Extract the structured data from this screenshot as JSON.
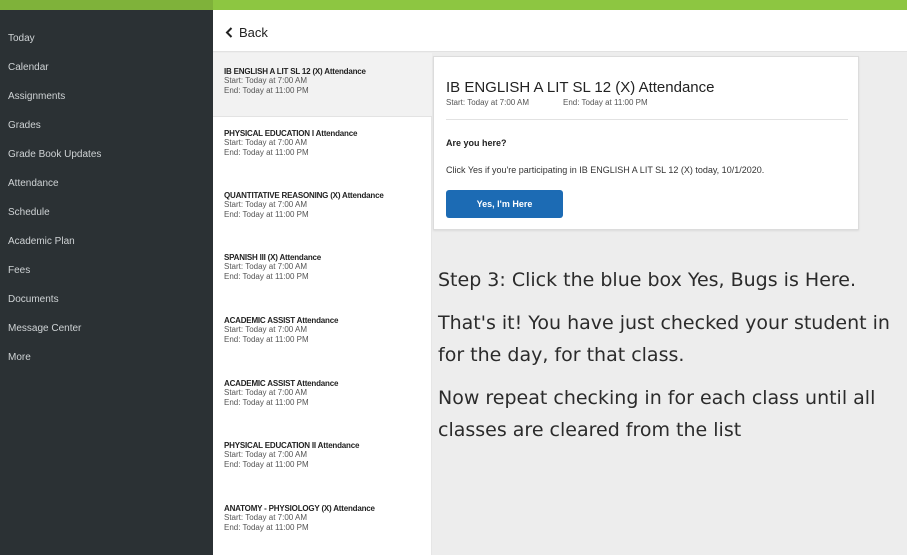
{
  "sidebar": {
    "items": [
      {
        "label": "Today"
      },
      {
        "label": "Calendar"
      },
      {
        "label": "Assignments"
      },
      {
        "label": "Grades"
      },
      {
        "label": "Grade Book Updates"
      },
      {
        "label": "Attendance"
      },
      {
        "label": "Schedule"
      },
      {
        "label": "Academic Plan"
      },
      {
        "label": "Fees"
      },
      {
        "label": "Documents"
      },
      {
        "label": "Message Center"
      },
      {
        "label": "More"
      }
    ]
  },
  "header": {
    "back_label": "Back"
  },
  "list": {
    "items": [
      {
        "title": "IB ENGLISH A LIT SL 12 (X) Attendance",
        "start": "Start: Today at 7:00 AM",
        "end": "End: Today at 11:00 PM"
      },
      {
        "title": "PHYSICAL EDUCATION I Attendance",
        "start": "Start: Today at 7:00 AM",
        "end": "End: Today at 11:00 PM"
      },
      {
        "title": "QUANTITATIVE REASONING (X) Attendance",
        "start": "Start: Today at 7:00 AM",
        "end": "End: Today at 11:00 PM"
      },
      {
        "title": "SPANISH III (X) Attendance",
        "start": "Start: Today at 7:00 AM",
        "end": "End: Today at 11:00 PM"
      },
      {
        "title": "ACADEMIC ASSIST Attendance",
        "start": "Start: Today at 7:00 AM",
        "end": "End: Today at 11:00 PM"
      },
      {
        "title": "ACADEMIC ASSIST Attendance",
        "start": "Start: Today at 7:00 AM",
        "end": "End: Today at 11:00 PM"
      },
      {
        "title": "PHYSICAL EDUCATION II Attendance",
        "start": "Start: Today at 7:00 AM",
        "end": "End: Today at 11:00 PM"
      },
      {
        "title": "ANATOMY - PHYSIOLOGY (X) Attendance",
        "start": "Start: Today at 7:00 AM",
        "end": "End: Today at 11:00 PM"
      }
    ]
  },
  "detail": {
    "title": "IB ENGLISH A LIT SL 12 (X) Attendance",
    "start": "Start: Today at 7:00 AM",
    "end": "End: Today at 11:00 PM",
    "question": "Are you here?",
    "description": "Click Yes if you're participating in IB ENGLISH A LIT SL 12 (X) today, 10/1/2020.",
    "button_label": "Yes, I'm Here"
  },
  "instructions": {
    "step3": "Step 3: Click the blue box Yes, Bugs is Here.",
    "done": "That's it! You have just checked your student in for the day, for that class.",
    "repeat": "Now repeat checking in for each class until all classes are cleared from the list"
  },
  "colors": {
    "accent_bar": "#8dc641",
    "sidebar_bg": "#2b3134",
    "button_blue": "#1c6bb4"
  },
  "icons": {
    "back": "chevron-left-icon"
  }
}
